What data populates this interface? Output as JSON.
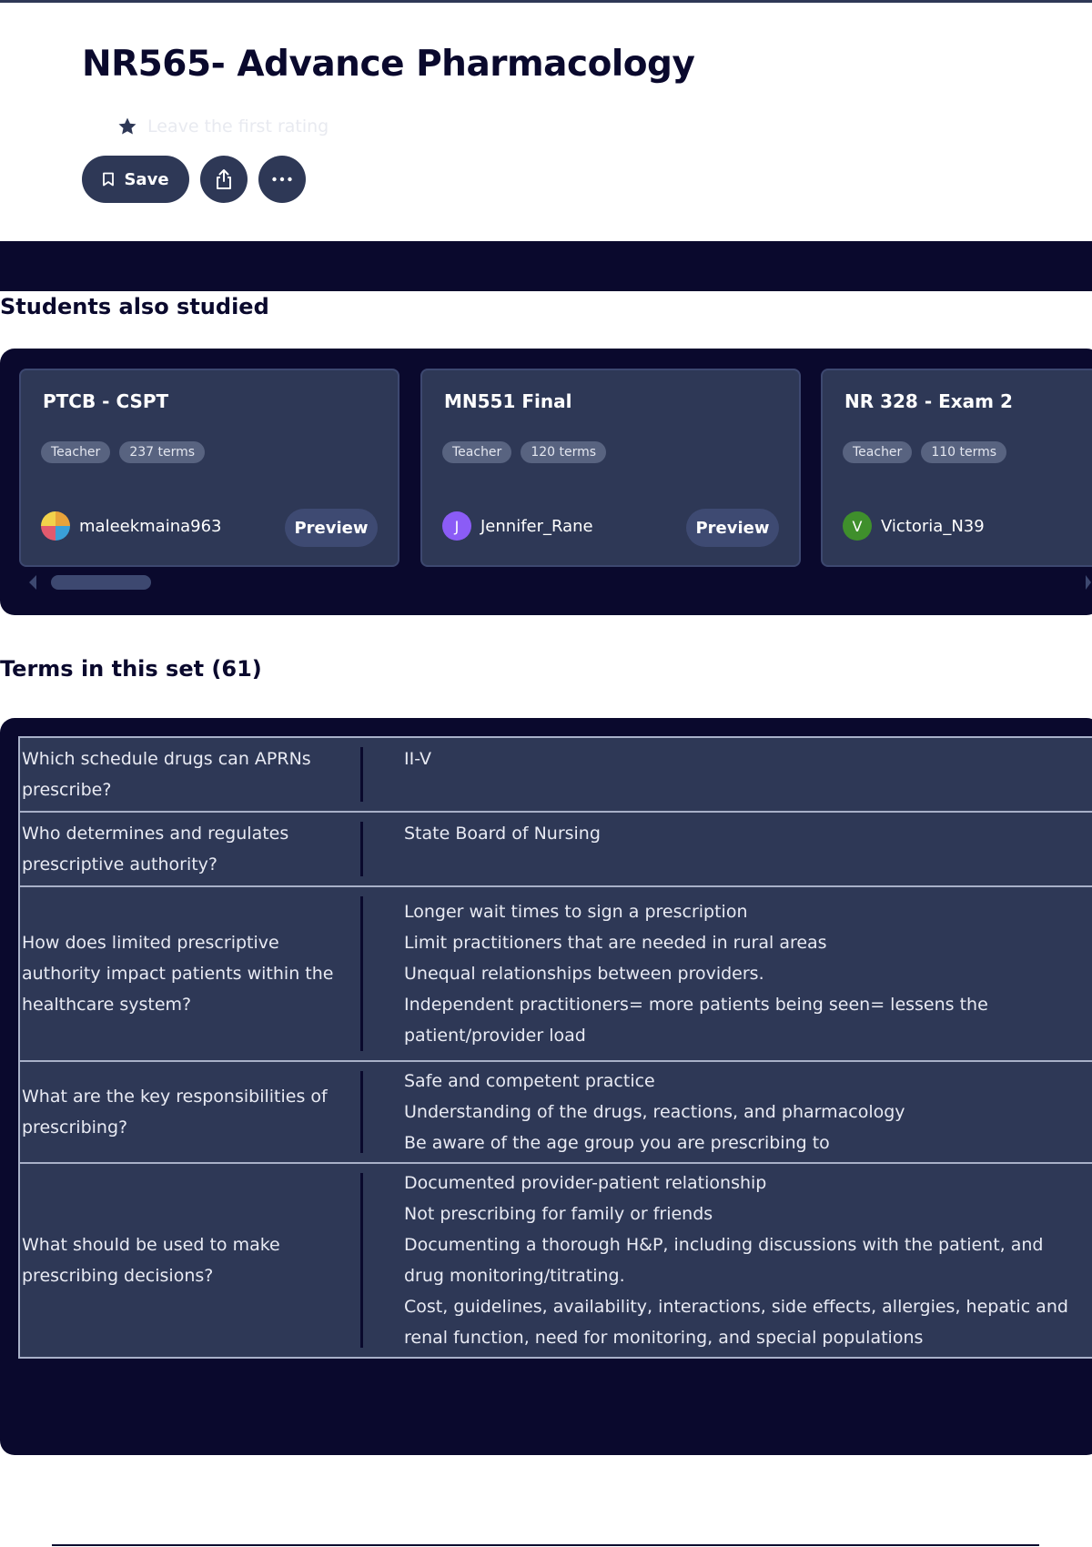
{
  "header": {
    "title": "NR565- Advance Pharmacology",
    "rating_prompt": "Leave the first rating"
  },
  "actions": {
    "save_label": "Save"
  },
  "students_also_studied": {
    "heading": "Students also studied",
    "cards": [
      {
        "title": "PTCB - CSPT",
        "badge_role": "Teacher",
        "badge_terms": "237 terms",
        "author": "maleekmaina963",
        "avatar_letter": "",
        "avatar_color": "#e8a33a",
        "preview_label": "Preview"
      },
      {
        "title": "MN551 Final",
        "badge_role": "Teacher",
        "badge_terms": "120 terms",
        "author": "Jennifer_Rane",
        "avatar_letter": "J",
        "avatar_color": "#8b5cf6",
        "preview_label": "Preview"
      },
      {
        "title": "NR 328 - Exam 2",
        "badge_role": "Teacher",
        "badge_terms": "110 terms",
        "author": "Victoria_N39",
        "avatar_letter": "V",
        "avatar_color": "#3f8f2c",
        "preview_label": ""
      }
    ]
  },
  "terms": {
    "heading": "Terms in this set (61)",
    "rows": [
      {
        "term": "Which schedule drugs can APRNs prescribe?",
        "definition": [
          "II-V"
        ]
      },
      {
        "term": "Who determines and regulates prescriptive authority?",
        "definition": [
          "State Board of Nursing"
        ]
      },
      {
        "term": "How does limited prescriptive authority impact patients within the healthcare system?",
        "definition": [
          "Longer wait times to sign a prescription",
          "Limit practitioners that are needed in rural areas",
          "Unequal relationships between providers.",
          "Independent practitioners= more patients being seen= lessens the patient/provider load"
        ]
      },
      {
        "term": "What are the key responsibilities of prescribing?",
        "definition": [
          "Safe and competent practice",
          "Understanding of the drugs, reactions, and pharmacology",
          "Be aware of the age group you are prescribing to"
        ]
      },
      {
        "term": "What should be used to make prescribing decisions?",
        "definition": [
          "Documented provider-patient relationship",
          "Not prescribing for family or friends",
          "Documenting a thorough H&P, including discussions with the patient, and drug monitoring/titrating.",
          "Cost, guidelines, availability, interactions, side effects, allergies, hepatic and renal function, need for monitoring, and special populations"
        ]
      }
    ]
  },
  "colors": {
    "navy": "#0a092d",
    "card": "#2e3856",
    "badge": "#586380"
  },
  "icons": {
    "rating": "star-icon",
    "save": "bookmark-icon",
    "share": "share-icon",
    "more": "more-icon",
    "scroll_left": "chevron-left-icon",
    "scroll_right": "chevron-right-icon"
  }
}
